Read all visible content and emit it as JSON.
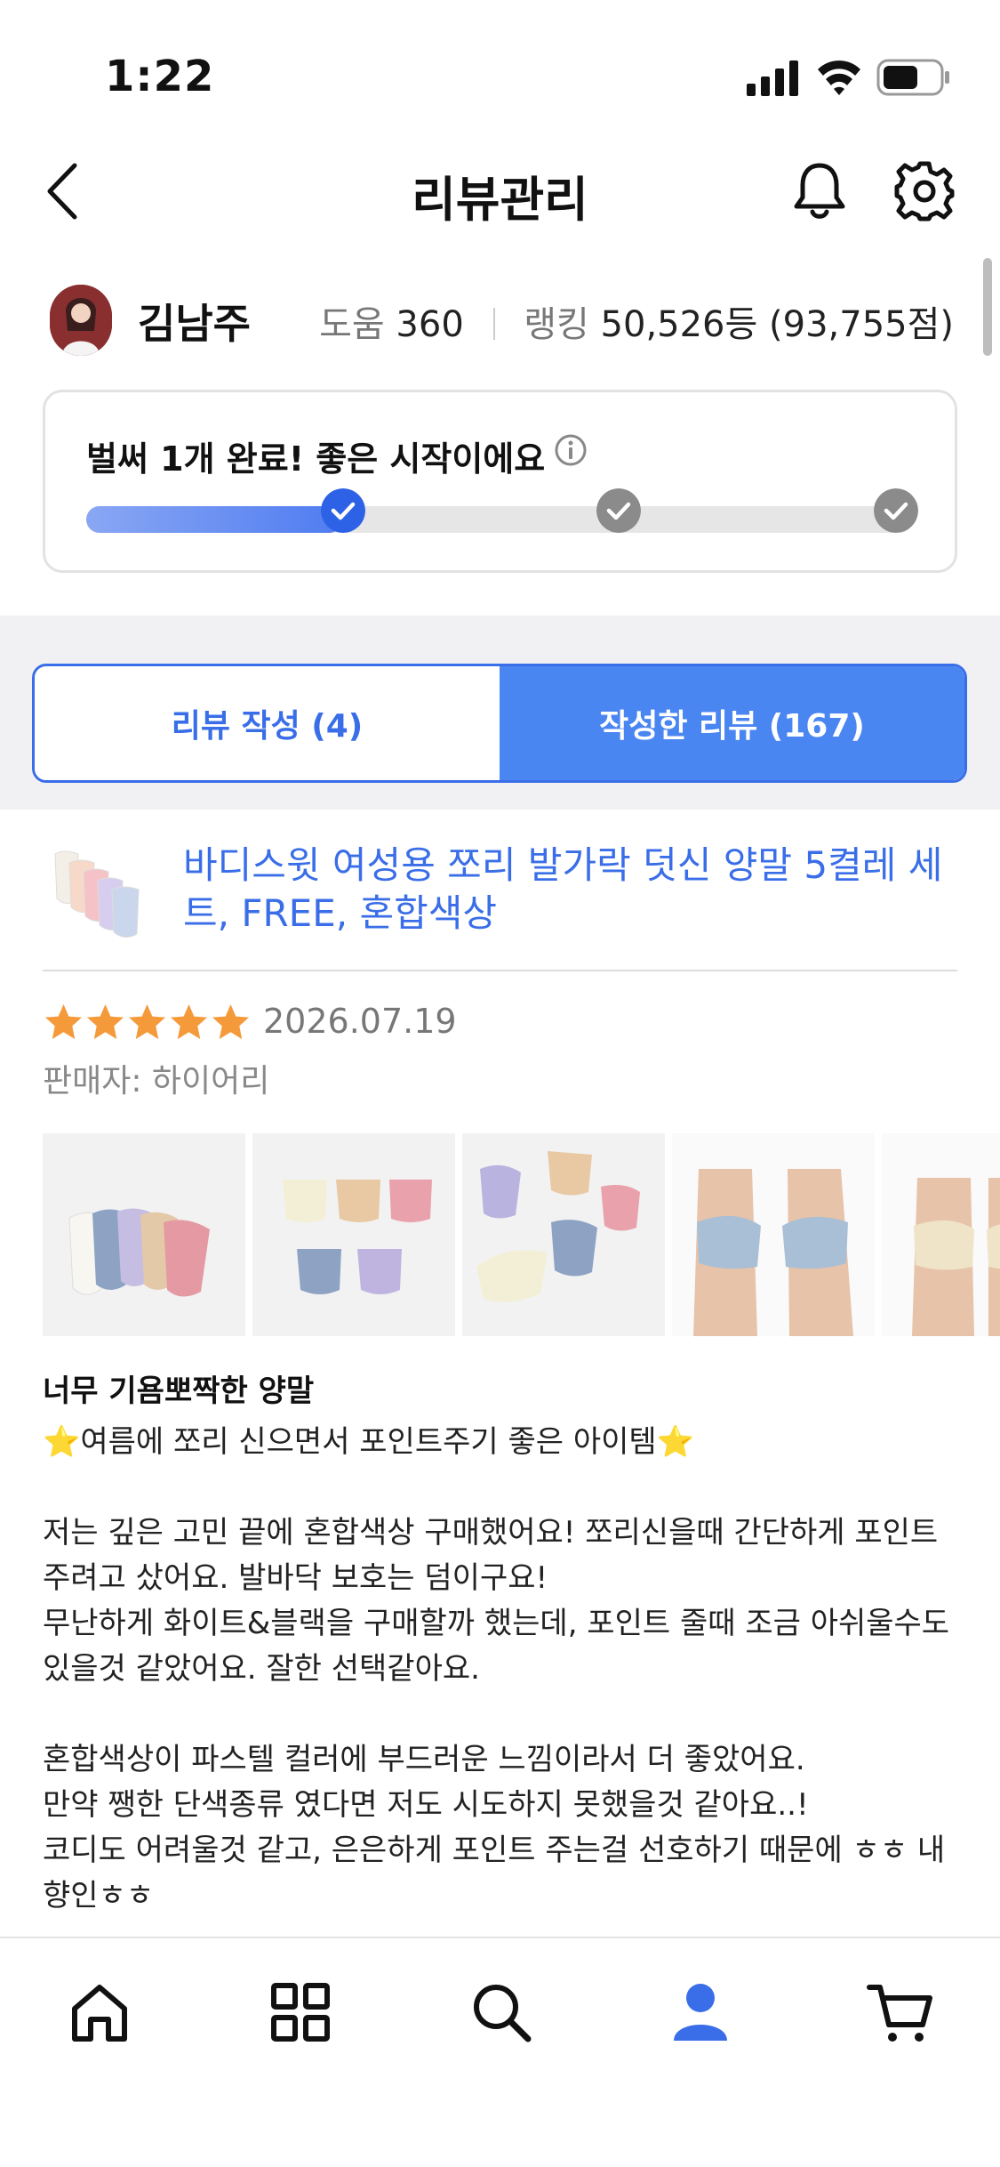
{
  "status_bar": {
    "time": "1:22"
  },
  "header": {
    "title": "리뷰관리"
  },
  "profile": {
    "name": "김남주",
    "help_label": "도움",
    "help_value": "360",
    "rank_label": "랭킹",
    "rank_value": "50,526등 (93,755점)"
  },
  "progress": {
    "message": "벌써 1개 완료! 좋은 시작이에요",
    "completed_steps": 1,
    "total_steps": 3,
    "fill_fraction": 0.31
  },
  "tabs": [
    {
      "label": "리뷰 작성 (4)",
      "active": false
    },
    {
      "label": "작성한 리뷰 (167)",
      "active": true
    }
  ],
  "review": {
    "product_name": "바디스윗 여성용 쪼리 발가락 덧신 양말 5켤레 세트, FREE, 혼합색상",
    "rating": 5,
    "date": "2026.07.19",
    "seller": "판매자: 하이어리",
    "photos": [
      "socks-fan-photo",
      "socks-grid-photo",
      "socks-pile-photo",
      "feet-blue-photo",
      "feet-beige-photo"
    ],
    "title": "너무 기욤뽀짝한 양말",
    "body_lines": [
      "⭐여름에 쪼리 신으면서 포인트주기 좋은 아이템⭐",
      "",
      "저는 깊은 고민 끝에 혼합색상 구매했어요! 쪼리신을때 간단하게 포인트 주려고 샀어요. 발바닥 보호는 덤이구요!",
      "무난하게 화이트&블랙을 구매할까 했는데, 포인트 줄때 조금 아쉬울수도 있을것 같았어요. 잘한 선택같아요.",
      "",
      "혼합색상이 파스텔 컬러에 부드러운 느낌이라서 더 좋았어요.",
      "만약 쨍한 단색종류 였다면 저도 시도하지 못했을것 같아요..!",
      "코디도 어려울것 같고, 은은하게 포인트 주는걸 선호하기 때문에 ㅎㅎ 내향인ㅎㅎ"
    ]
  },
  "nav": [
    {
      "icon": "home-icon",
      "active": false
    },
    {
      "icon": "category-grid-icon",
      "active": false
    },
    {
      "icon": "search-icon",
      "active": false
    },
    {
      "icon": "profile-icon",
      "active": true
    },
    {
      "icon": "cart-icon",
      "active": false
    }
  ],
  "colors": {
    "accent": "#3a6ee8",
    "tab_active": "#4a86f2",
    "star": "#f59a3a"
  }
}
